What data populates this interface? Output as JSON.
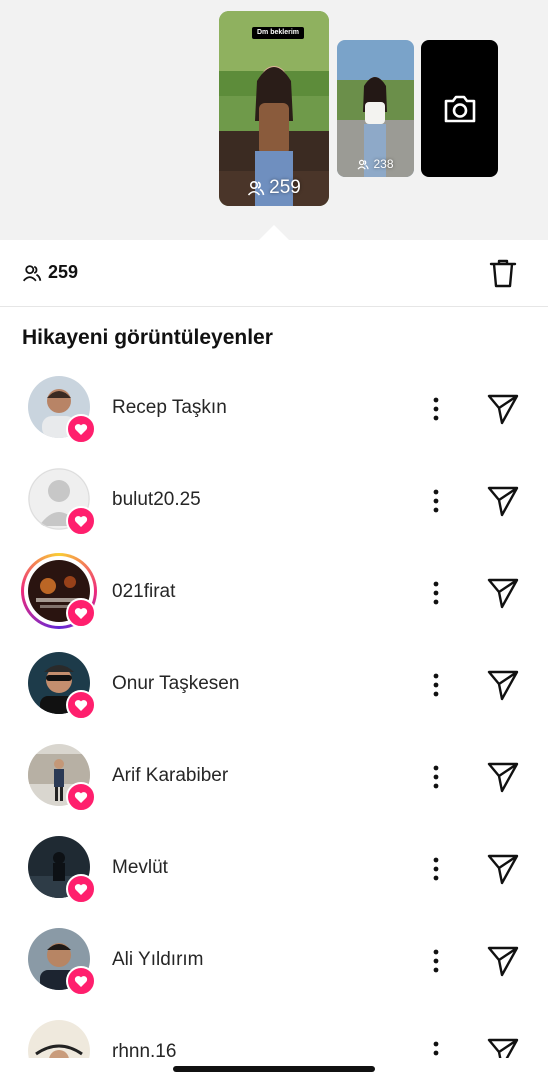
{
  "stories": {
    "main": {
      "badge": "Dm beklerim",
      "viewer_count": "259",
      "icon": "viewers-icon"
    },
    "second": {
      "viewer_count": "238",
      "icon": "viewers-icon"
    },
    "camera": {
      "icon": "camera-icon"
    }
  },
  "stats": {
    "viewer_count": "259",
    "icon": "viewers-icon",
    "delete_icon": "trash-icon"
  },
  "section_title": "Hikayeni görüntüleyenler",
  "viewers": [
    {
      "name": "Recep Taşkın",
      "avatar": "photo",
      "liked": true
    },
    {
      "name": "bulut20.25",
      "avatar": "default",
      "liked": true
    },
    {
      "name": "021firat",
      "avatar": "photo-story-ring",
      "liked": true
    },
    {
      "name": "Onur Taşkesen",
      "avatar": "photo",
      "liked": true
    },
    {
      "name": "Arif Karabiber",
      "avatar": "photo",
      "liked": true
    },
    {
      "name": "Mevlüt",
      "avatar": "photo",
      "liked": true
    },
    {
      "name": "Ali Yıldırım",
      "avatar": "photo",
      "liked": true
    },
    {
      "name": "rhnn.16",
      "avatar": "photo",
      "liked": true
    }
  ],
  "colors": {
    "like_badge": "#ff1f6d",
    "background_top": "#f2f2f2",
    "text": "#262626"
  }
}
